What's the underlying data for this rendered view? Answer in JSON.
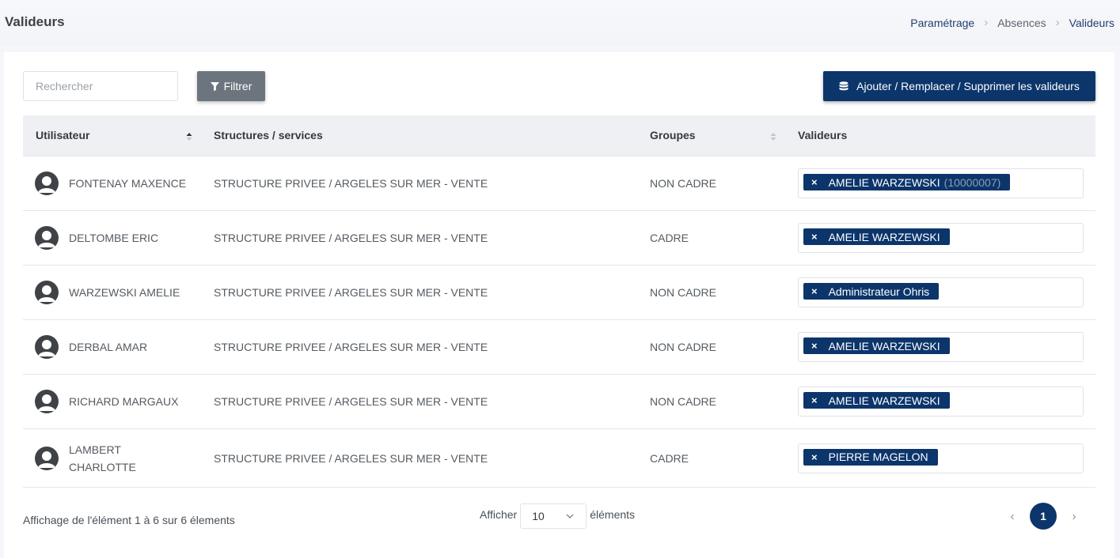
{
  "header": {
    "title": "Valideurs",
    "breadcrumb": [
      "Paramétrage",
      "Absences",
      "Valideurs"
    ]
  },
  "toolbar": {
    "search_placeholder": "Rechercher",
    "filter_label": "Filtrer",
    "add_label": "Ajouter / Remplacer / Supprimer les valideurs"
  },
  "table": {
    "columns": [
      "Utilisateur",
      "Structures / services",
      "Groupes",
      "Valideurs"
    ],
    "rows": [
      {
        "user": "FONTENAY MAXENCE",
        "structure": "STRUCTURE PRIVEE / ARGELES SUR MER - VENTE",
        "group": "NON CADRE",
        "validator": "AMELIE WARZEWSKI",
        "validator_code": "(10000007)"
      },
      {
        "user": "DELTOMBE ERIC",
        "structure": "STRUCTURE PRIVEE / ARGELES SUR MER - VENTE",
        "group": "CADRE",
        "validator": "AMELIE WARZEWSKI"
      },
      {
        "user": "WARZEWSKI AMELIE",
        "structure": "STRUCTURE PRIVEE / ARGELES SUR MER - VENTE",
        "group": "NON CADRE",
        "validator": "Administrateur Ohris"
      },
      {
        "user": "DERBAL AMAR",
        "structure": "STRUCTURE PRIVEE / ARGELES SUR MER - VENTE",
        "group": "NON CADRE",
        "validator": "AMELIE WARZEWSKI"
      },
      {
        "user": "RICHARD MARGAUX",
        "structure": "STRUCTURE PRIVEE / ARGELES SUR MER - VENTE",
        "group": "NON CADRE",
        "validator": "AMELIE WARZEWSKI"
      },
      {
        "user": "LAMBERT CHARLOTTE",
        "structure": "STRUCTURE PRIVEE / ARGELES SUR MER - VENTE",
        "group": "CADRE",
        "validator": "PIERRE MAGELON"
      }
    ],
    "tag_remove": "×"
  },
  "footer": {
    "info": "Affichage de l'élément 1 à 6 sur 6 élements",
    "show_label": "Afficher",
    "page_length": "10",
    "elements_label": "éléments",
    "prev": "‹",
    "current_page": "1",
    "next": "›"
  },
  "colors": {
    "primary": "#0c356b",
    "secondary": "#6c757d",
    "header_bg": "#eef0f4"
  }
}
